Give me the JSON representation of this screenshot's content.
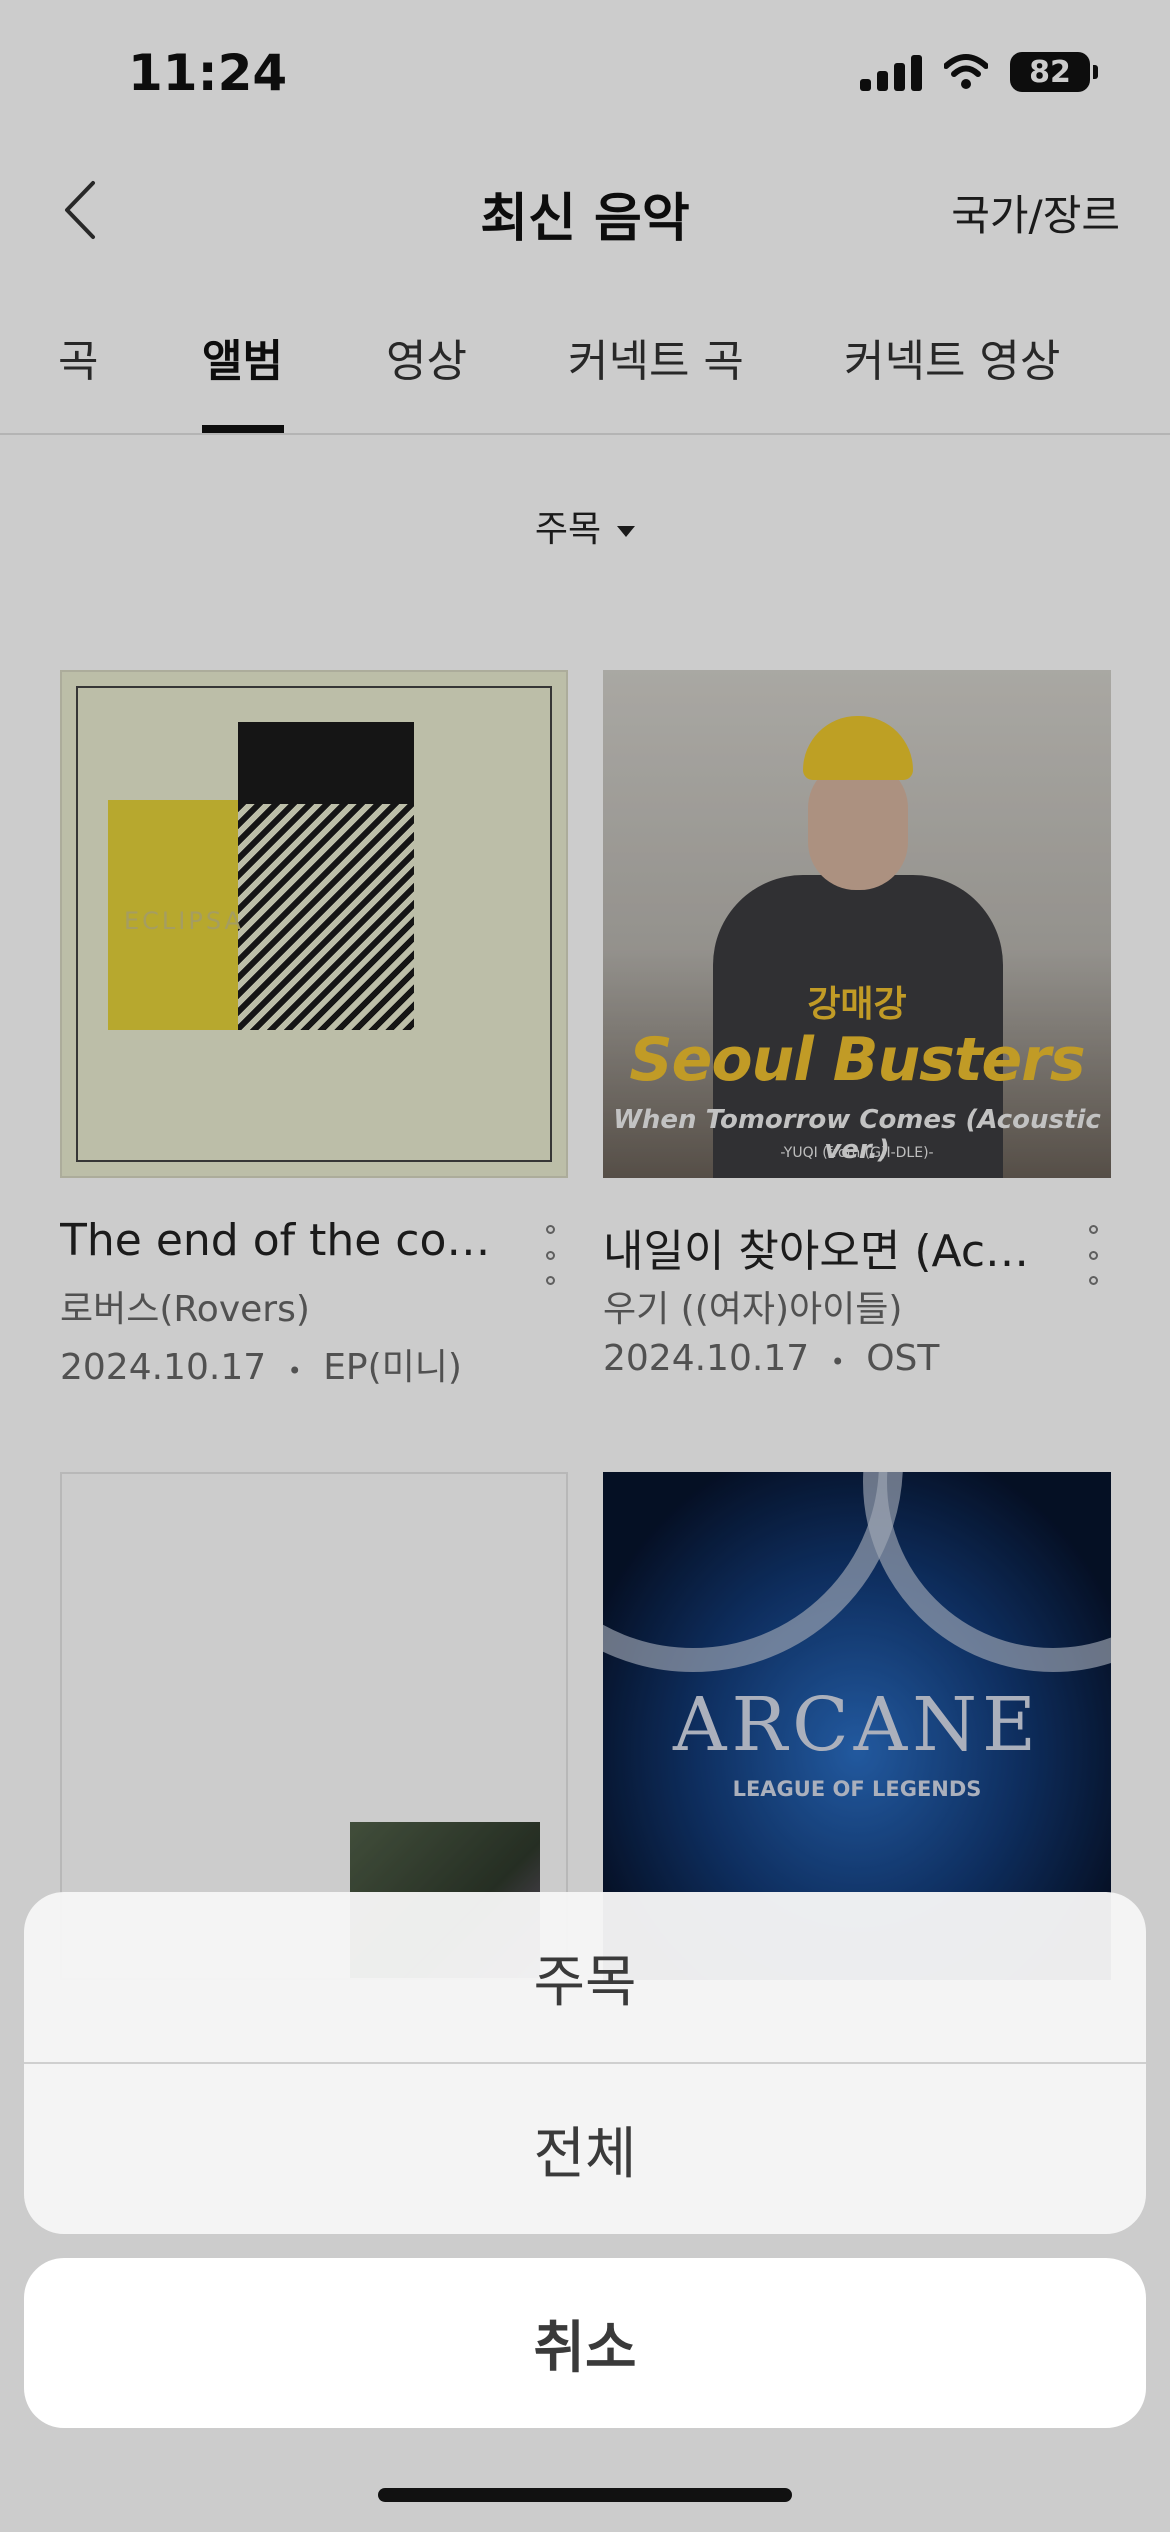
{
  "status_bar": {
    "time": "11:24",
    "battery": "82"
  },
  "header": {
    "title": "최신 음악",
    "action": "국가/장르"
  },
  "tabs": [
    {
      "label": "곡"
    },
    {
      "label": "앨범"
    },
    {
      "label": "영상"
    },
    {
      "label": "커넥트 곡"
    },
    {
      "label": "커넥트 영상"
    }
  ],
  "active_tab": "앨범",
  "filter": {
    "label": "주목"
  },
  "albums": [
    {
      "title": "The end of the con…",
      "artist": "로버스(Rovers)",
      "date": "2024.10.17",
      "type": "EP(미니)",
      "cover_text": "ECLIPSA"
    },
    {
      "title": "내일이 찾아오면 (Ac…",
      "artist": "우기 ((여자)아이들)",
      "date": "2024.10.17",
      "type": "OST",
      "cover_sub": "강매강",
      "cover_title": "Seoul Busters",
      "cover_subtitle": "When Tomorrow Comes (Acoustic ver.)",
      "cover_credit": "-YUQI (from (G)I-DLE)-"
    },
    {},
    {
      "cover_title": "ARCANE",
      "cover_sub": "LEAGUE OF LEGENDS"
    }
  ],
  "action_sheet": {
    "options": [
      "주목",
      "전체"
    ],
    "cancel": "취소"
  }
}
